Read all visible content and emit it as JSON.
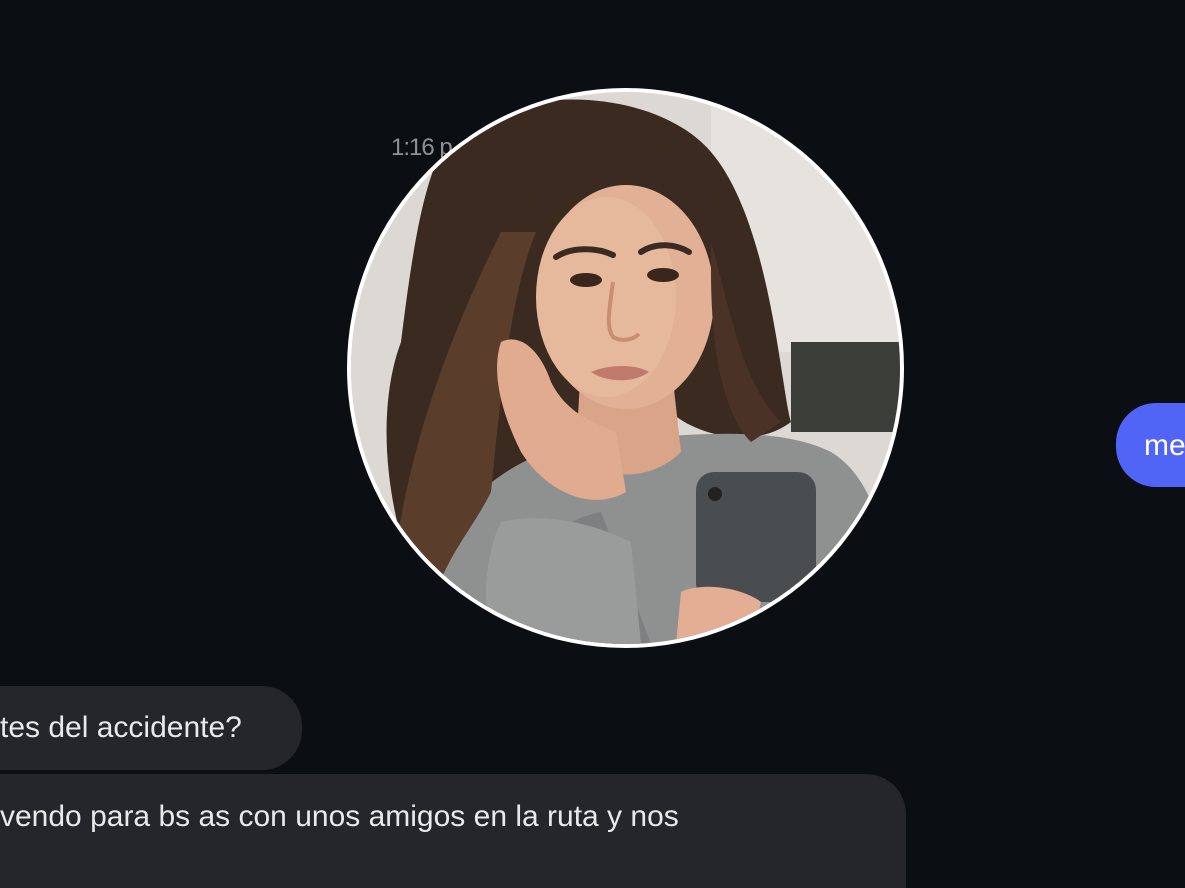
{
  "chat": {
    "timestamp": "1:16 p",
    "messages": [
      {
        "direction": "incoming",
        "text": "tes del accidente?"
      },
      {
        "direction": "incoming",
        "text": "vendo para bs as con unos amigos en la ruta y nos"
      },
      {
        "direction": "outgoing",
        "text": "me"
      }
    ]
  },
  "avatar": {
    "icon": "profile-photo",
    "description": "woman-holding-phone"
  },
  "colors": {
    "background": "#0b0e13",
    "incoming_bubble": "#24262b",
    "outgoing_bubble": "#5064f6",
    "avatar_border": "#ffffff"
  }
}
